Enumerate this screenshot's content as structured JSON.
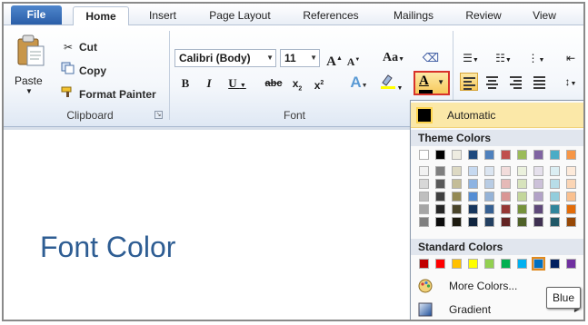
{
  "tabs": [
    {
      "label": "File"
    },
    {
      "label": "Home"
    },
    {
      "label": "Insert"
    },
    {
      "label": "Page Layout"
    },
    {
      "label": "References"
    },
    {
      "label": "Mailings"
    },
    {
      "label": "Review"
    },
    {
      "label": "View"
    }
  ],
  "clipboard": {
    "paste": "Paste",
    "cut": "Cut",
    "copy": "Copy",
    "format_painter": "Format Painter",
    "label": "Clipboard"
  },
  "font": {
    "label": "Font",
    "name": "Calibri (Body)",
    "size": "11"
  },
  "document": {
    "heading": "Font Color"
  },
  "color_menu": {
    "automatic": "Automatic",
    "theme_heading": "Theme Colors",
    "standard_heading": "Standard Colors",
    "more_colors": "More Colors...",
    "gradient": "Gradient",
    "tooltip": "Blue",
    "theme_top": [
      "#ffffff",
      "#000000",
      "#eeece1",
      "#1f497d",
      "#4f81bd",
      "#c0504d",
      "#9bbb59",
      "#8064a2",
      "#4bacc6",
      "#f79646"
    ],
    "theme_shades": [
      [
        "#f2f2f2",
        "#7f7f7f",
        "#ddd9c3",
        "#c6d9f0",
        "#dbe5f1",
        "#f2dcdb",
        "#ebf1dd",
        "#e5e0ec",
        "#dbeef3",
        "#fdeada"
      ],
      [
        "#d8d8d8",
        "#595959",
        "#c4bd97",
        "#8db3e2",
        "#b8cce4",
        "#e5b9b7",
        "#d7e3bc",
        "#ccc1d9",
        "#b7dde8",
        "#fbd5b5"
      ],
      [
        "#bfbfbf",
        "#3f3f3f",
        "#938953",
        "#548dd4",
        "#95b3d7",
        "#d99694",
        "#c3d69b",
        "#b2a2c7",
        "#92cddc",
        "#fac08f"
      ],
      [
        "#a5a5a5",
        "#262626",
        "#494429",
        "#17365d",
        "#366092",
        "#953734",
        "#76923c",
        "#5f497a",
        "#31859b",
        "#e36c09"
      ],
      [
        "#7f7f7f",
        "#0c0c0c",
        "#1d1b10",
        "#0f243e",
        "#244061",
        "#632423",
        "#4f6128",
        "#3f3151",
        "#205867",
        "#974806"
      ]
    ],
    "standard": [
      "#c00000",
      "#ff0000",
      "#ffc000",
      "#ffff00",
      "#92d050",
      "#00b050",
      "#00b0f0",
      "#0070c0",
      "#002060",
      "#7030a0"
    ],
    "selected_standard_index": 7
  }
}
